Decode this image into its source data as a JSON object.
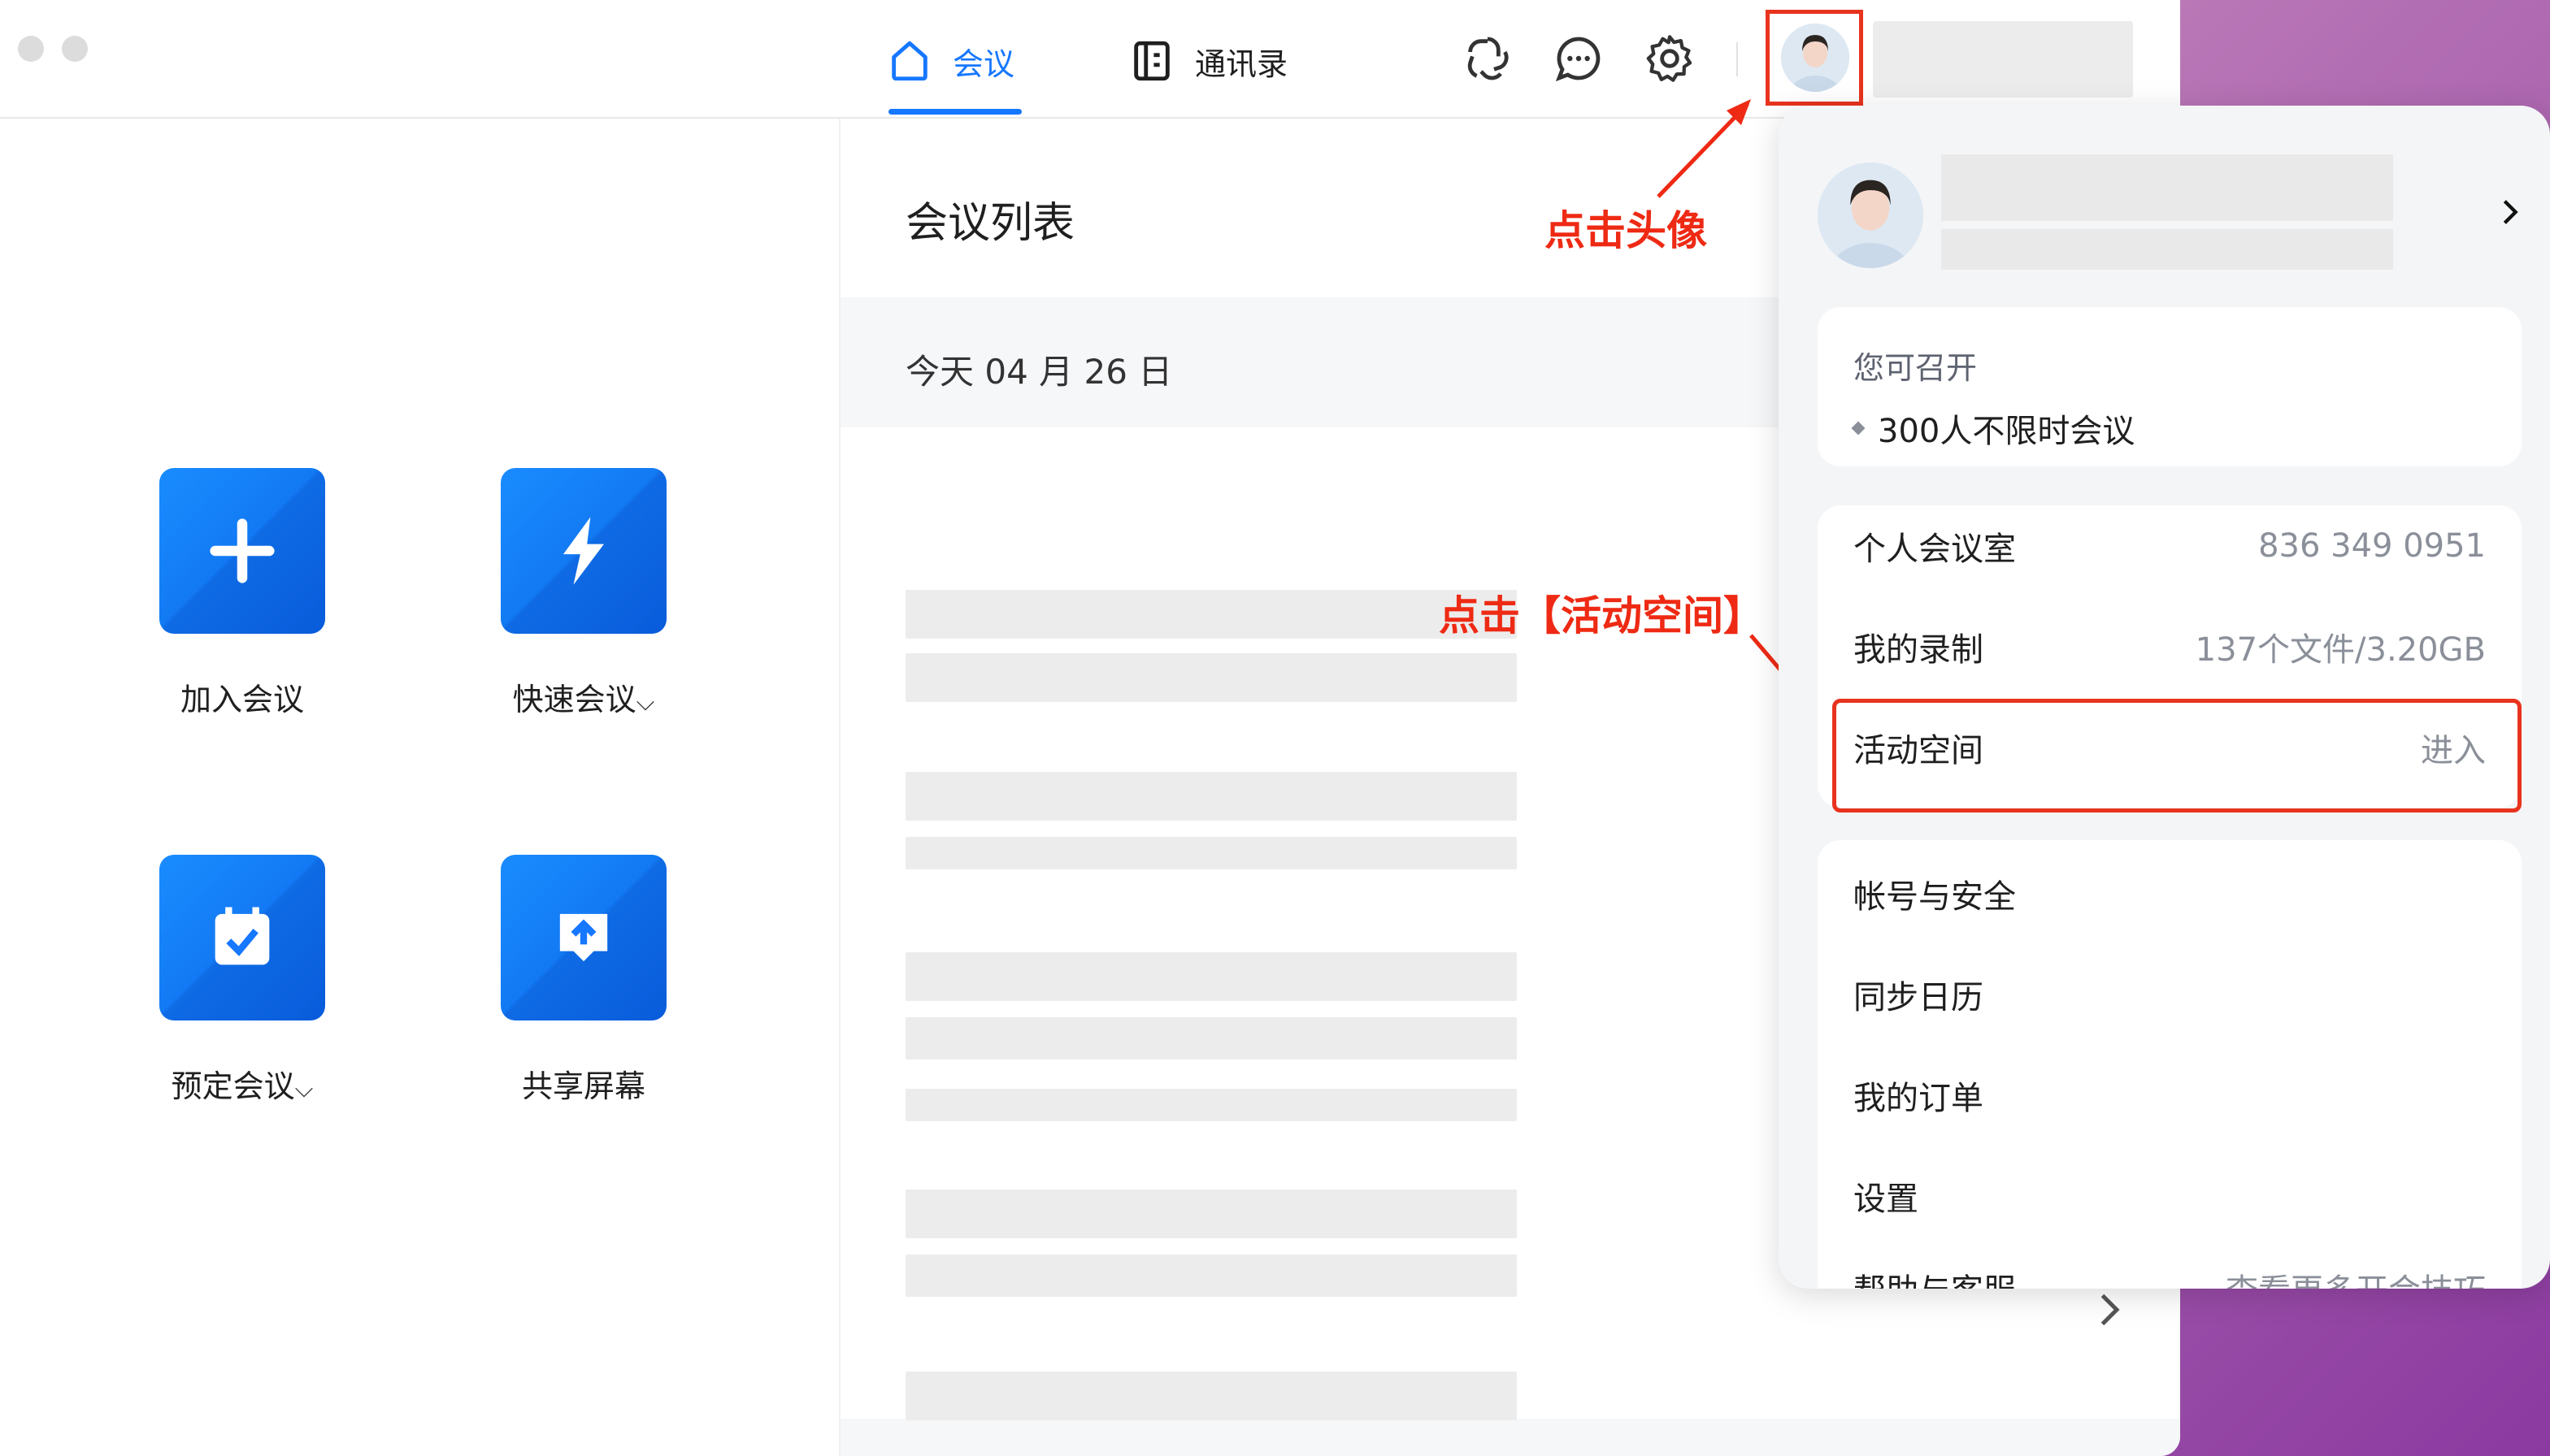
{
  "tabs": [
    {
      "label": "会议",
      "icon": "home-icon",
      "active": true
    },
    {
      "label": "通讯录",
      "icon": "contacts-icon",
      "active": false
    }
  ],
  "toolbar_icons": [
    "ai-assistant-icon",
    "chat-icon",
    "settings-icon"
  ],
  "actions": [
    {
      "label": "加入会议",
      "icon": "plus-icon",
      "dropdown": false
    },
    {
      "label": "快速会议",
      "icon": "lightning-icon",
      "dropdown": true
    },
    {
      "label": "预定会议",
      "icon": "calendar-check-icon",
      "dropdown": true
    },
    {
      "label": "共享屏幕",
      "icon": "share-screen-icon",
      "dropdown": false
    }
  ],
  "meeting_list": {
    "title": "会议列表",
    "date": "今天  04 月 26 日"
  },
  "annotations": {
    "click_avatar": "点击头像",
    "click_activity": "点击【活动空间】"
  },
  "popover": {
    "capability": {
      "title": "您可召开",
      "item": "300人不限时会议"
    },
    "info_rows": [
      {
        "label": "个人会议室",
        "value": "836 349 0951"
      },
      {
        "label": "我的录制",
        "value": "137个文件/3.20GB"
      },
      {
        "label": "活动空间",
        "value": "进入"
      }
    ],
    "menu": [
      "帐号与安全",
      "同步日历",
      "我的订单",
      "设置"
    ],
    "help": {
      "label": "帮助与客服",
      "value": "查看更多开会技巧"
    }
  },
  "colors": {
    "accent": "#1677ff",
    "annotation_red": "#ee2a14"
  }
}
